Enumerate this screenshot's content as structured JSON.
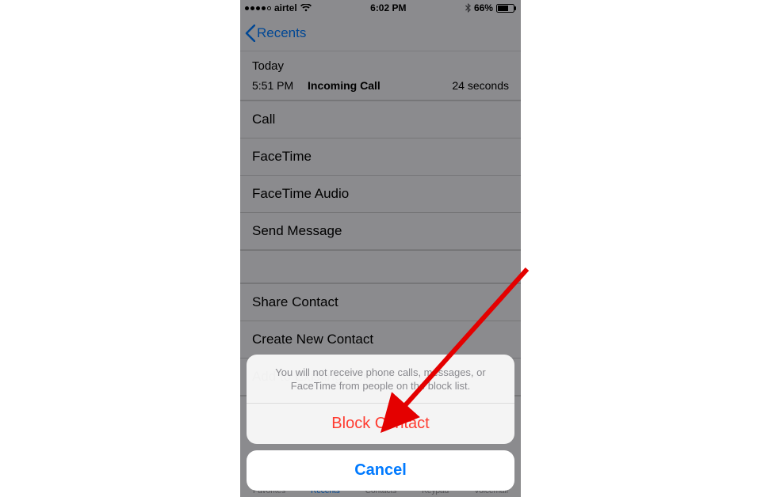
{
  "status": {
    "carrier": "airtel",
    "time": "6:02 PM",
    "battery_pct": "66%",
    "signal_filled": 4,
    "signal_total": 5
  },
  "nav": {
    "back_label": "Recents"
  },
  "call_log": {
    "day_label": "Today",
    "time": "5:51 PM",
    "type": "Incoming Call",
    "duration": "24 seconds"
  },
  "actions_primary": [
    "Call",
    "FaceTime",
    "FaceTime Audio",
    "Send Message"
  ],
  "actions_secondary": [
    "Share Contact",
    "Create New Contact",
    "Add to Existing Contact"
  ],
  "tabs": [
    "Favorites",
    "Recents",
    "Contacts",
    "Keypad",
    "Voicemail"
  ],
  "sheet": {
    "message": "You will not receive phone calls, messages, or FaceTime from people on the block list.",
    "destructive": "Block Contact",
    "cancel": "Cancel"
  },
  "colors": {
    "ios_blue": "#007aff",
    "ios_red": "#ff3b30"
  }
}
